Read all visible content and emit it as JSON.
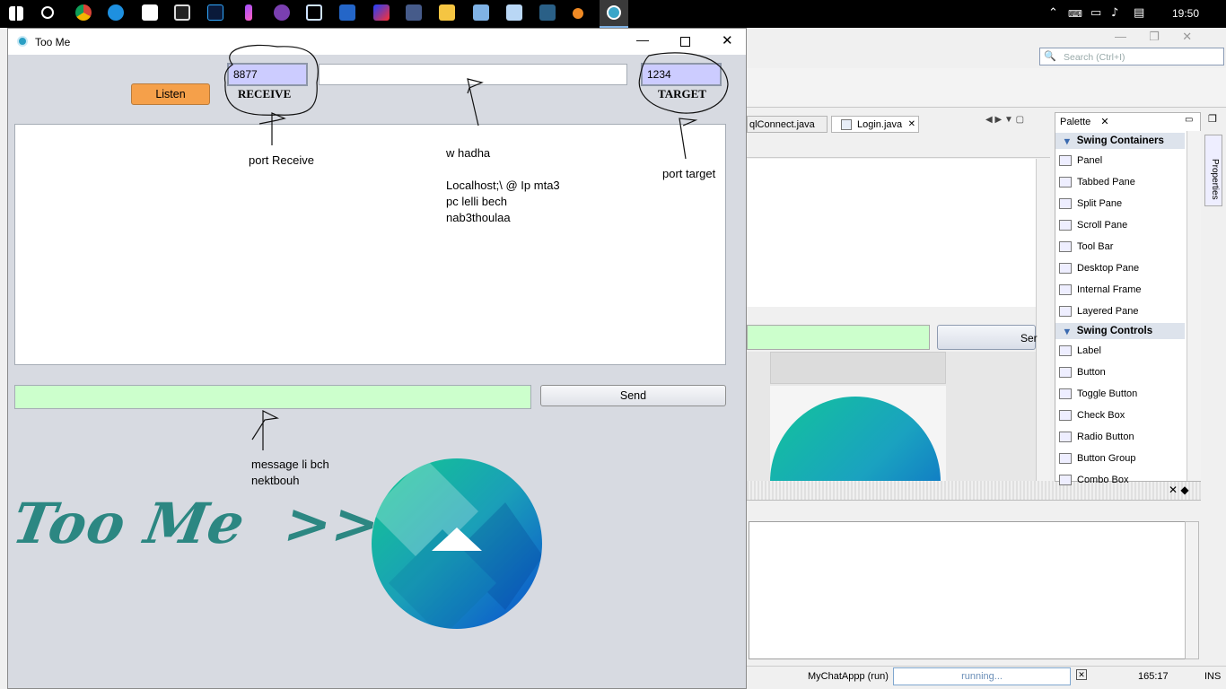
{
  "taskbar": {
    "clock": "19:50",
    "tray_lang": "~"
  },
  "window": {
    "title": "Too Me",
    "receive_port": "8877",
    "target_ip": "",
    "target_port": "1234",
    "receive_label": "RECEIVE",
    "target_label": "TARGET",
    "listen_label": "Listen",
    "send_label": "Send",
    "message_value": "",
    "logo_text": "Too Me  >>"
  },
  "annotations": {
    "port_receive": "port Receive",
    "ip_note": "w hadha\n\nLocalhost;\\ @ Ip mta3\npc lelli bech\nnab3thoulaa",
    "port_target": "port target",
    "message_note": "message li bch\nnektbouh"
  },
  "ide": {
    "search_placeholder": "Search (Ctrl+I)",
    "tabs": [
      "qlConnect.java",
      "Login.java"
    ],
    "palette_title": "Palette",
    "properties_label": "Properties",
    "swing_containers": "Swing Containers",
    "containers": [
      "Panel",
      "Tabbed Pane",
      "Split Pane",
      "Scroll Pane",
      "Tool Bar",
      "Desktop Pane",
      "Internal Frame",
      "Layered Pane"
    ],
    "swing_controls": "Swing Controls",
    "controls": [
      "Label",
      "Button",
      "Toggle Button",
      "Check Box",
      "Radio Button",
      "Button Group",
      "Combo Box"
    ],
    "send_partial": "Ser",
    "status_project": "MyChatAppp (run)",
    "status_running": "running...",
    "status_pos": "165:17",
    "status_mode": "INS"
  },
  "colors": {
    "window_bg": "#d7dae1",
    "listen_button": "#f5a04a",
    "port_field": "#ccccff",
    "message_field": "#ccffcc",
    "logo_teal": "#1a7f78"
  }
}
